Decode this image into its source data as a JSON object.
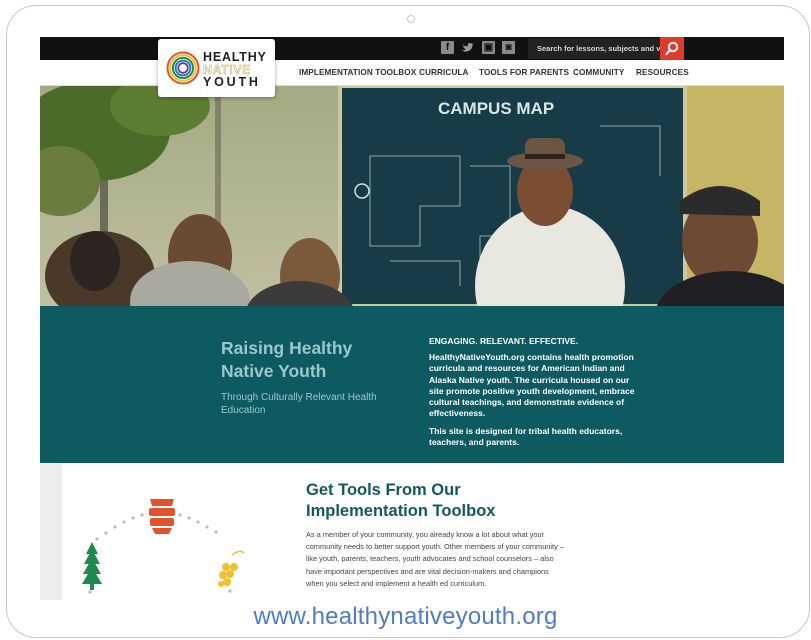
{
  "topbar": {
    "social_icons": [
      "facebook-icon",
      "twitter-icon",
      "youtube-icon",
      "instagram-icon"
    ],
    "search_placeholder": "Search for lessons, subjects and videos"
  },
  "logo": {
    "line1": "HEALTHY",
    "line2": "NATIVE",
    "line3": "YOUTH"
  },
  "nav": {
    "items": [
      "IMPLEMENTATION TOOLBOX",
      "CURRICULA",
      "TOOLS FOR PARENTS",
      "COMMUNITY",
      "RESOURCES"
    ]
  },
  "hero": {
    "sign_text": "CAMPUS MAP"
  },
  "banner": {
    "title": "Raising Healthy Native Youth",
    "subtitle": "Through Culturally Relevant Health Education",
    "heading": "ENGAGING. RELEVANT. EFFECTIVE.",
    "paragraph1": "HealthyNativeYouth.org contains health promotion curricula and resources for American Indian and Alaska Native youth. The curricula housed on our site promote positive youth development, embrace cultural teachings, and demonstrate evidence of effectiveness.",
    "paragraph2": "This site is designed for tribal health educators, teachers, and parents."
  },
  "tools": {
    "title": "Get Tools From Our Implementation Toolbox",
    "body": "As a member of your community, you already know a lot about what your community needs to better support youth. Other members of your community – like youth, parents, teachers, youth advocates and school counselors – also have important perspectives and are vital decision-makers and champions when you select and implement a health ed curriculum."
  },
  "caption": {
    "url": "www.healthynativeyouth.org"
  },
  "colors": {
    "teal": "#0d5a61",
    "teal_light_text": "#9bc7cd",
    "search_red": "#e03a2e",
    "link_blue": "#4e7dc4",
    "tree_green": "#1e8a4c",
    "basket_orange": "#e2532c",
    "grapes_yellow": "#f0c12e"
  }
}
